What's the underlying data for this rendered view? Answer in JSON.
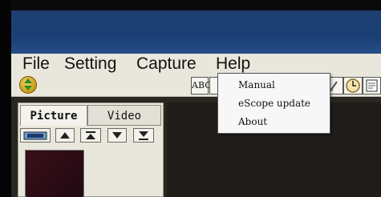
{
  "menubar": {
    "items": [
      "File",
      "Setting",
      "Capture",
      "Help"
    ]
  },
  "help_menu": {
    "items": [
      "Manual",
      "eScope update",
      "About"
    ]
  },
  "toolbar": {
    "text_tool_label": "ABC"
  },
  "left_panel": {
    "tabs": [
      "Picture",
      "Video"
    ],
    "active_tab": "Picture"
  },
  "icons": {
    "nav": "up-down-circle-icon",
    "camera": "camera-icon",
    "up": "triangle-up-icon",
    "top": "skip-to-top-icon",
    "down": "triangle-down-icon",
    "bottom": "skip-to-bottom-icon",
    "clock": "clock-icon"
  },
  "colors": {
    "titlebar": "#1b3f75",
    "menubar": "#e9e7dc",
    "accent_gold": "#c89b15"
  }
}
